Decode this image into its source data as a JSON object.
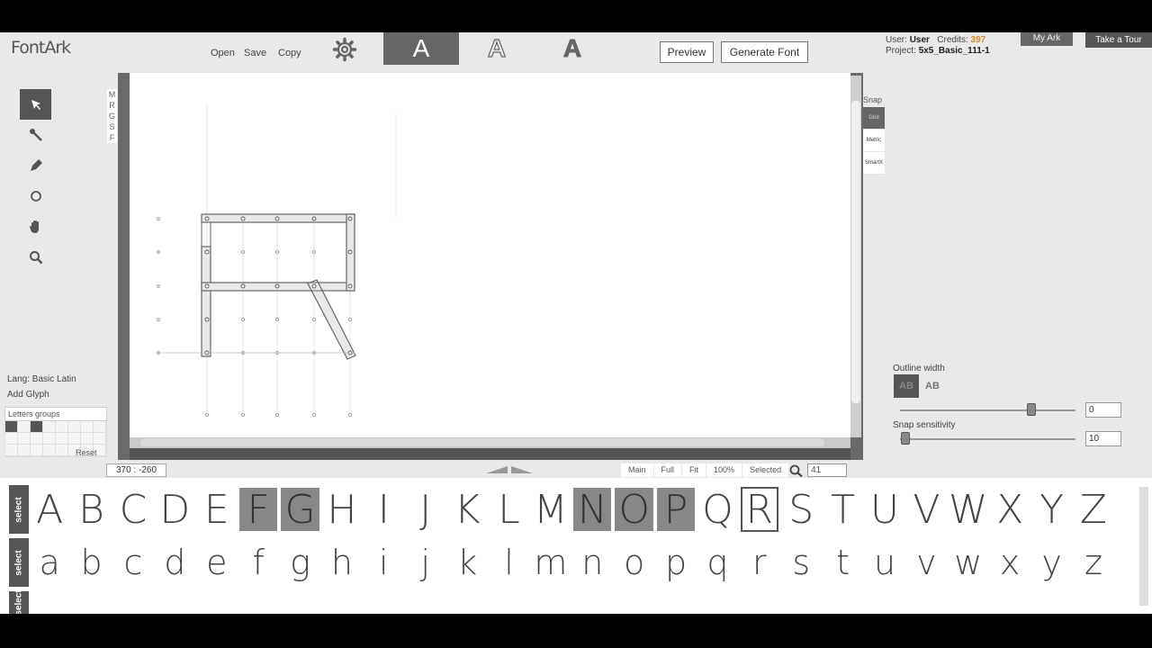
{
  "header": {
    "logo": "FontArk",
    "open_label": "Open",
    "save_label": "Save",
    "copy_label": "Copy",
    "modes": [
      "A",
      "A",
      "A"
    ],
    "preview_label": "Preview",
    "generate_label": "Generate Font",
    "user_prefix": "User:",
    "user_name": "User",
    "credits_prefix": "Credits:",
    "credits": "397",
    "project_prefix": "Project:",
    "project_name": "5x5_Basic_111-1",
    "myark_label": "My Ark",
    "tour_label": "Take a Tour"
  },
  "tools": [
    "select-arrow",
    "node-tool",
    "pen-tool",
    "circle-tool",
    "hand-tool",
    "zoom-tool"
  ],
  "layers": [
    "M",
    "R",
    "G",
    "S",
    "F"
  ],
  "snap": {
    "title": "Snap",
    "items": [
      "Grid",
      "Metric",
      "SmartX"
    ]
  },
  "outline": {
    "label": "Outline width",
    "ab_filled": "AB",
    "ab_outline": "AB",
    "width_value": "0",
    "width_level": 0.75,
    "snap_label": "Snap sensitivity",
    "snap_value": "10",
    "snap_level": 0.0
  },
  "left_panel": {
    "lang": "Lang: Basic Latin",
    "add_glyph": "Add Glyph",
    "groups_title": "Letters groups",
    "reset": "Reset"
  },
  "status": {
    "coords": "370 : -260",
    "zoom_buttons": [
      "Main",
      "Full",
      "Fit",
      "100%",
      "Selected"
    ],
    "zoom_value": "41"
  },
  "letters": {
    "select_label": "select",
    "upper": [
      "A",
      "B",
      "C",
      "D",
      "E",
      "F",
      "G",
      "H",
      "I",
      "J",
      "K",
      "L",
      "M",
      "N",
      "O",
      "P",
      "Q",
      "R",
      "S",
      "T",
      "U",
      "V",
      "W",
      "X",
      "Y",
      "Z"
    ],
    "lower": [
      "a",
      "b",
      "c",
      "d",
      "e",
      "f",
      "g",
      "h",
      "i",
      "j",
      "k",
      "l",
      "m",
      "n",
      "o",
      "p",
      "q",
      "r",
      "s",
      "t",
      "u",
      "v",
      "w",
      "x",
      "y",
      "z"
    ],
    "edited_upper": [
      "F",
      "G",
      "N",
      "O",
      "P"
    ],
    "selected_upper": "R"
  }
}
